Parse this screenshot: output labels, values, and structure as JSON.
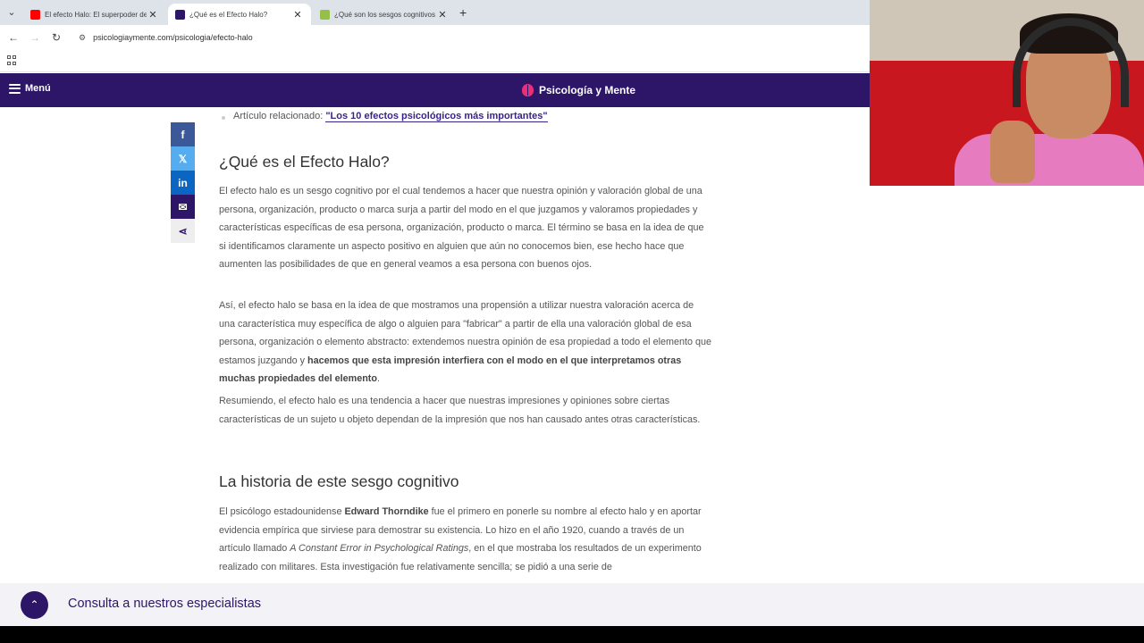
{
  "browser": {
    "tabs": [
      {
        "title": "El efecto Halo: El superpoder de",
        "favicon_color": "#ff0000",
        "active": false
      },
      {
        "title": "¿Qué es el Efecto Halo?",
        "favicon_color": "#2d1567",
        "active": true
      },
      {
        "title": "¿Qué son los sesgos cognitivos",
        "favicon_color": "#95bf47",
        "active": false
      }
    ],
    "url": "psicologiaymente.com/psicologia/efecto-halo"
  },
  "site": {
    "menu_label": "Menú",
    "logo_text": "Psicología y Mente",
    "brand_color": "#2d1567",
    "accent_color": "#e8307a"
  },
  "share": {
    "icons": [
      "facebook-icon",
      "x-icon",
      "linkedin-icon",
      "mail-icon",
      "share-icon"
    ]
  },
  "article": {
    "related_prefix": "Artículo relacionado:",
    "related_link": "\"Los 10 efectos psicológicos más importantes\"",
    "heading1": "¿Qué es el Efecto Halo?",
    "p1": "El efecto halo es un sesgo cognitivo por el cual tendemos a hacer que nuestra opinión y valoración global de una persona, organización, producto o marca surja a partir del modo en el que juzgamos y valoramos propiedades y características específicas de esa persona, organización, producto o marca. El término se basa en la idea de que si identificamos claramente un aspecto positivo en alguien que aún no conocemos bien, ese hecho hace que aumenten las posibilidades de que en general veamos a esa persona con buenos ojos.",
    "p2_start": "Así, el efecto halo se basa en la idea de que mostramos una propensión a utilizar nuestra valoración acerca de una característica muy específica de algo o alguien para \"fabricar\" a partir de ella una valoración global de esa persona, organización o elemento abstracto: extendemos nuestra opinión de esa propiedad a todo el elemento que estamos juzgando y ",
    "p2_bold": "hacemos que esta impresión interfiera con el modo en el que interpretamos otras muchas propiedades del elemento",
    "p2_end": ".",
    "p3": "Resumiendo, el efecto halo es una tendencia a hacer que nuestras impresiones y opiniones sobre ciertas características de un sujeto u objeto dependan de la impresión que nos han causado antes otras características.",
    "heading2": "La historia de este sesgo cognitivo",
    "p4_start": "El psicólogo estadounidense ",
    "p4_bold": "Edward Thorndike",
    "p4_mid": " fue el primero en ponerle su nombre al efecto halo y en aportar evidencia empírica que sirviese para demostrar su existencia. Lo hizo en el año 1920, cuando a través de un artículo llamado ",
    "p4_italic": "A Constant Error in Psychological Ratings",
    "p4_end": ", en el que mostraba los resultados de un experimento realizado con militares. Esta investigación fue relativamente sencilla; se pidió a una serie de"
  },
  "footer": {
    "consult_label": "Consulta a nuestros especialistas"
  }
}
